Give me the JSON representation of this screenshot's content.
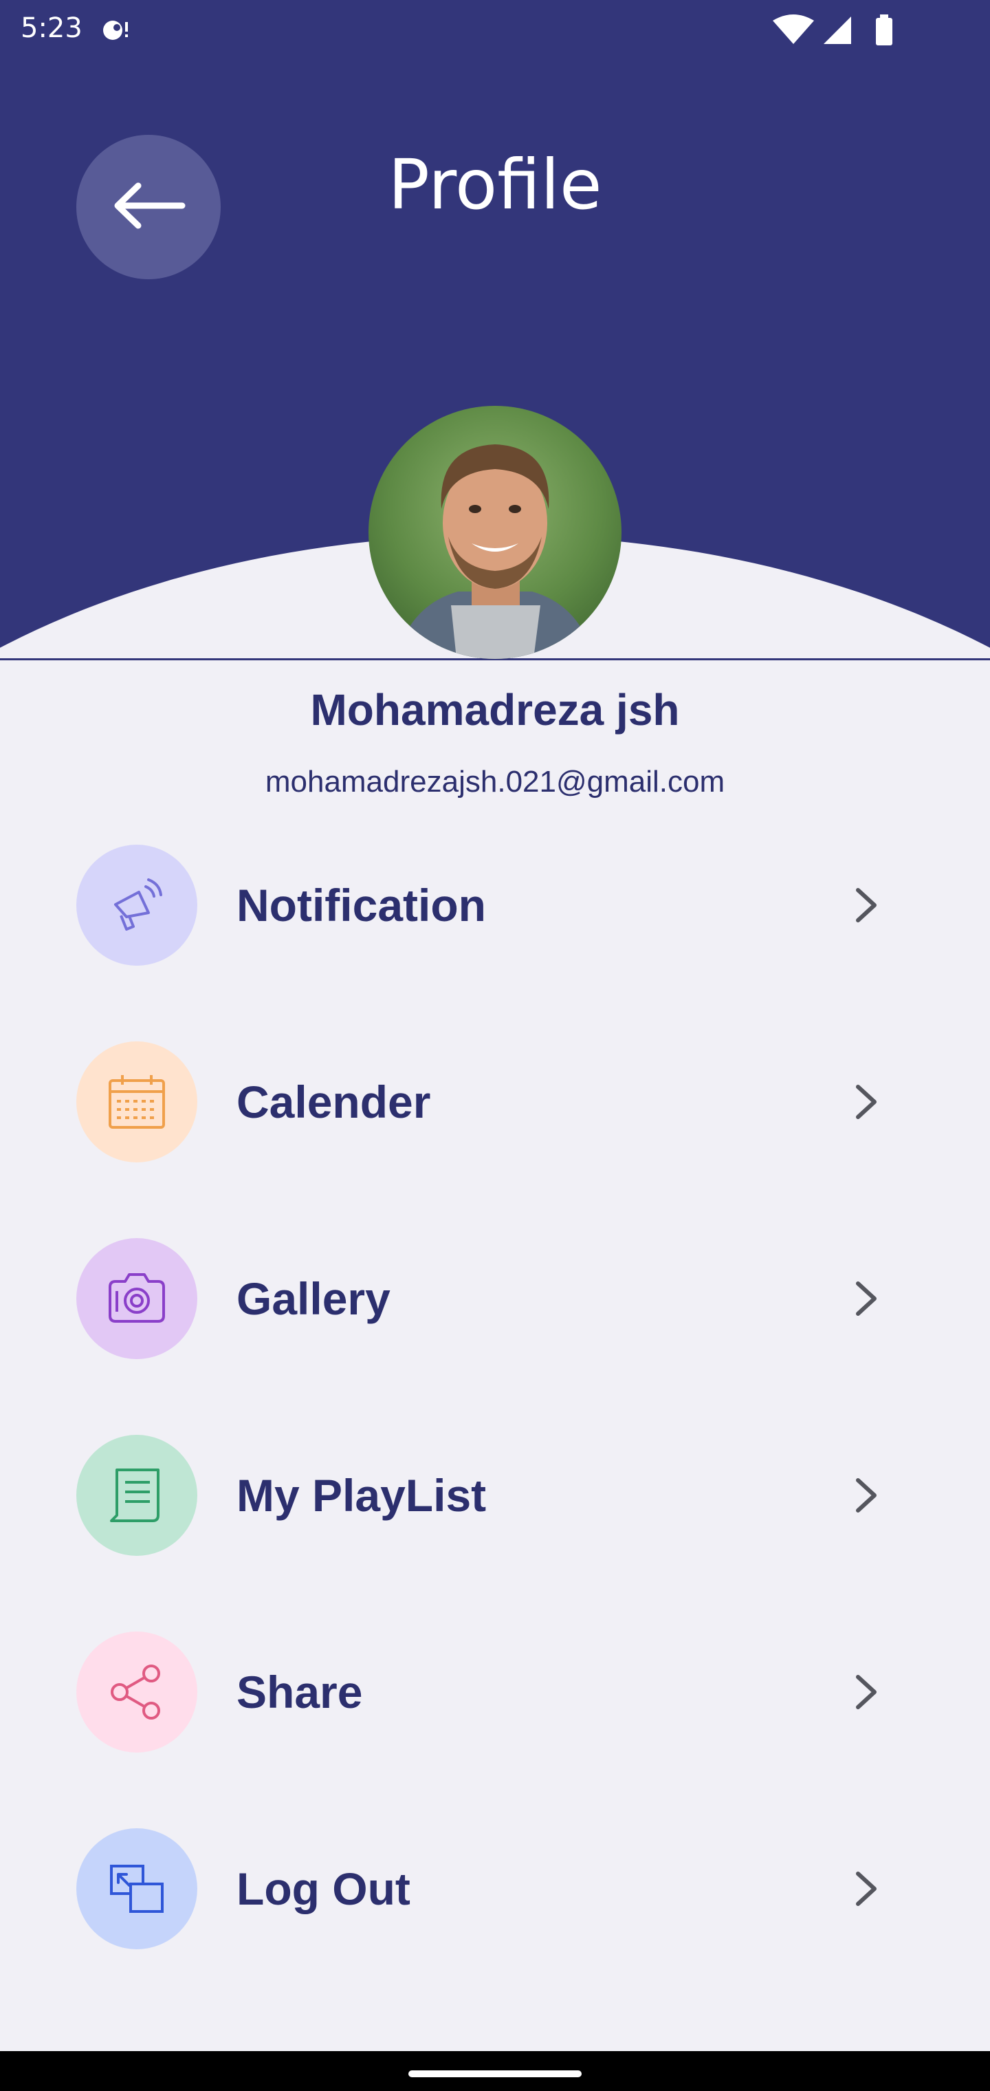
{
  "status_bar": {
    "time": "5:23"
  },
  "header": {
    "title": "Profile",
    "background_color": "#33367A",
    "back_icon": "arrow-left-icon"
  },
  "profile": {
    "name": "Mohamadreza jsh",
    "email": "mohamadrezajsh.021@gmail.com"
  },
  "menu": {
    "items": [
      {
        "label": "Notification",
        "icon": "megaphone-icon",
        "icon_bg": "#D6D5FA",
        "icon_color": "#7470D8"
      },
      {
        "label": "Calender",
        "icon": "calendar-icon",
        "icon_bg": "#FFE3CE",
        "icon_color": "#F0A04B"
      },
      {
        "label": "Gallery",
        "icon": "camera-icon",
        "icon_bg": "#E2C8F5",
        "icon_color": "#8A3FC9"
      },
      {
        "label": "My PlayList",
        "icon": "playlist-icon",
        "icon_bg": "#BFE6D4",
        "icon_color": "#2E9E68"
      },
      {
        "label": "Share",
        "icon": "share-icon",
        "icon_bg": "#FFDDEB",
        "icon_color": "#E05A82"
      },
      {
        "label": "Log Out",
        "icon": "logout-icon",
        "icon_bg": "#C5D4FB",
        "icon_color": "#2F56D8"
      }
    ]
  },
  "colors": {
    "accent": "#33367A",
    "text": "#2C2F6E",
    "background": "#F1F0F6"
  }
}
